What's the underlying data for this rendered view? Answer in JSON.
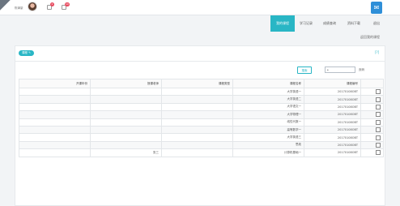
{
  "header": {
    "user_name": "陈婵豪",
    "badges": [
      "2",
      "10"
    ],
    "logo_glyph": "✉"
  },
  "nav": {
    "tabs": [
      {
        "label": "我的课程",
        "active": true
      },
      {
        "label": "学习记录",
        "active": false
      },
      {
        "label": "成绩查询",
        "active": false
      },
      {
        "label": "资料下载",
        "active": false
      },
      {
        "label": "退出",
        "active": false
      }
    ]
  },
  "page_link": "返回我的课程",
  "panel": {
    "tag_label": "课程 ✎",
    "help_glyph": "[?]",
    "search_button": "搜索",
    "search_value": "*",
    "search_suffix": "页码"
  },
  "table": {
    "headers": [
      "",
      "课程编号",
      "课程名称",
      "课程类型",
      "授课老师",
      "开课年份"
    ],
    "rows": [
      [
        "",
        "20170108OBT",
        "大学英语一",
        "",
        "",
        ""
      ],
      [
        "",
        "20170108OBT",
        "大学英语二",
        "",
        "",
        ""
      ],
      [
        "",
        "20170108OBT",
        "大学语文一",
        "",
        "",
        ""
      ],
      [
        "",
        "20170108OBT",
        "大学物理一",
        "",
        "",
        ""
      ],
      [
        "",
        "20170108OBT",
        "线性代数一",
        "",
        "",
        ""
      ],
      [
        "",
        "20170108OBT",
        "高等数学一",
        "",
        "",
        ""
      ],
      [
        "",
        "20170108OBT",
        "大学英语三",
        "",
        "",
        ""
      ],
      [
        "",
        "20170108OBT",
        "思政",
        "",
        "",
        ""
      ],
      [
        "",
        "20170108OBT",
        "计算机基础一",
        "",
        "张三",
        ""
      ]
    ]
  }
}
